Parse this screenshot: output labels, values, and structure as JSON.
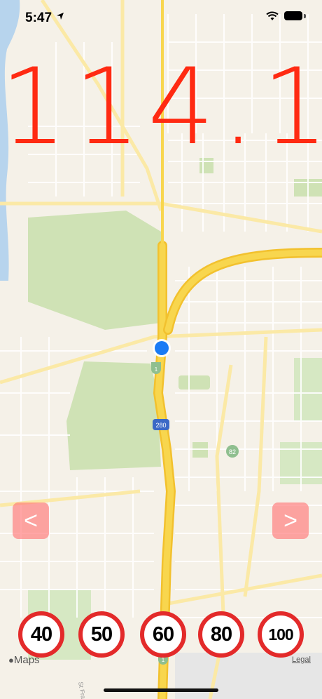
{
  "status_bar": {
    "time": "5:47"
  },
  "speed": {
    "value": "114.1",
    "color": "#ff2a12"
  },
  "navigation": {
    "prev_label": "<",
    "next_label": ">"
  },
  "speed_limits": [
    {
      "label": "40"
    },
    {
      "label": "50"
    },
    {
      "label": "60"
    },
    {
      "label": "80"
    },
    {
      "label": "100"
    }
  ],
  "map": {
    "attribution": "Maps",
    "legal_label": "Legal",
    "route_shields": [
      "1",
      "280",
      "82",
      "1"
    ],
    "street_label": "St Fran"
  },
  "colors": {
    "map_background": "#f5f1e8",
    "park": "#cfe2b5",
    "highway": "#f7d54a",
    "sign_border": "#e32a2a",
    "button": "#ff7878",
    "location_dot": "#1a7bf5"
  }
}
